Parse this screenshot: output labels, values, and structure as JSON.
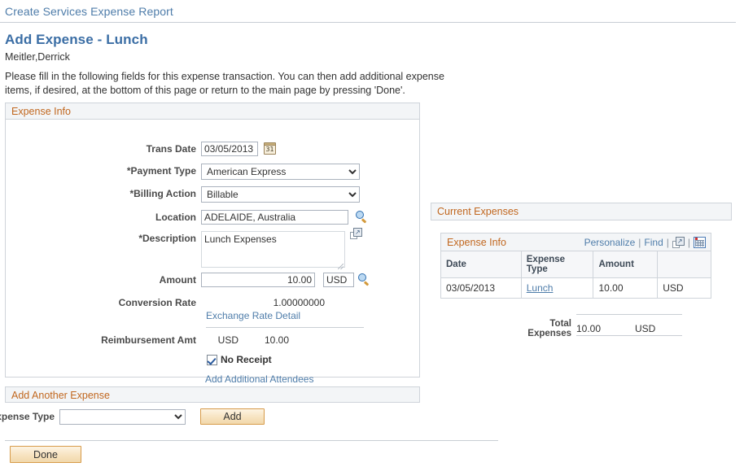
{
  "breadcrumb": {
    "label": "Create Services Expense Report"
  },
  "header": {
    "title": "Add Expense - Lunch",
    "subtitle": "Meitler,Derrick",
    "instructions": "Please fill in the following fields for this expense transaction. You can then add additional expense items, if desired, at the bottom of this page or return to the main page by pressing 'Done'."
  },
  "expense_info": {
    "section_title": "Expense Info",
    "fields": {
      "trans_date_label": "Trans Date",
      "trans_date_value": "03/05/2013",
      "payment_type_label": "*Payment Type",
      "payment_type_value": "American Express",
      "billing_action_label": "*Billing Action",
      "billing_action_value": "Billable",
      "location_label": "Location",
      "location_value": "ADELAIDE, Australia",
      "description_label": "*Description",
      "description_value": "Lunch Expenses",
      "amount_label": "Amount",
      "amount_value": "10.00",
      "amount_currency": "USD",
      "conversion_rate_label": "Conversion Rate",
      "conversion_rate_value": "1.00000000",
      "exchange_rate_link": "Exchange Rate Detail",
      "reimbursement_label": "Reimbursement Amt",
      "reimbursement_currency": "USD",
      "reimbursement_value": "10.00",
      "no_receipt_label": "No Receipt",
      "add_attendees_link": "Add Additional Attendees"
    },
    "icons": {
      "calendar": "calendar-icon",
      "calendar_day": "31",
      "location_lookup": "lookup-icon",
      "description_expand": "expand-icon",
      "currency_lookup": "lookup-icon"
    }
  },
  "add_another": {
    "section_title": "Add Another Expense",
    "expense_type_label": "Expense Type",
    "expense_type_value": "",
    "add_button": "Add"
  },
  "footer": {
    "done_button": "Done"
  },
  "current_expenses": {
    "section_title": "Current Expenses",
    "grid_title": "Expense Info",
    "tools": {
      "personalize": "Personalize",
      "find": "Find",
      "separator": "|",
      "zoom_icon": "expand-grid-icon",
      "download_icon": "download-spreadsheet-icon"
    },
    "columns": [
      "Date",
      "Expense Type",
      "Amount",
      ""
    ],
    "rows": [
      {
        "date": "03/05/2013",
        "expense_type": "Lunch",
        "amount": "10.00",
        "currency": "USD"
      }
    ],
    "total_label": "Total Expenses",
    "total_value": "10.00",
    "total_currency": "USD"
  },
  "colors": {
    "link": "#4f7daa",
    "section_heading": "#c1671f",
    "title": "#3b6ea5",
    "button_border": "#d79b4a"
  }
}
